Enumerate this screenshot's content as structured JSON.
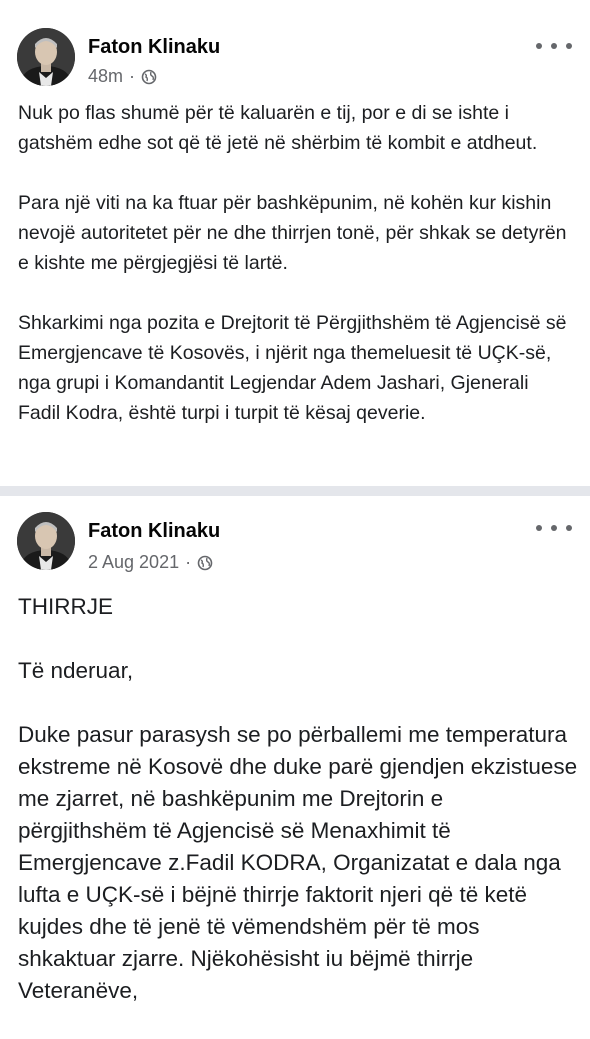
{
  "posts": [
    {
      "author": "Faton Klinaku",
      "time": "48m",
      "separator": "·",
      "privacy_icon": "globe-icon",
      "more_icon": "more-options-icon",
      "paragraphs": [
        "Nuk po flas shumë për të kaluarën e tij, por e di se ishte i gatshëm edhe sot që të jetë në shërbim të kombit e atdheut.",
        "Para një viti na ka ftuar për bashkëpunim, në kohën kur kishin nevojë autoritetet për ne dhe thirrjen tonë, për shkak se detyrën e kishte me përgjegjësi të lartë.",
        "Shkarkimi nga pozita e Drejtorit të Përgjithshëm të Agjencisë së Emergjencave të Kosovës, i njërit nga themeluesit të UÇK-së, nga grupi i Komandantit Legjendar Adem Jashari, Gjenerali Fadil Kodra, është turpi i turpit të kësaj qeverie."
      ]
    },
    {
      "author": "Faton Klinaku",
      "time": "2 Aug 2021",
      "separator": "·",
      "privacy_icon": "globe-icon",
      "more_icon": "more-options-icon",
      "paragraphs": [
        "THIRRJE",
        "Të nderuar,",
        "Duke pasur parasysh se po përballemi me temperatura ekstreme në Kosovë dhe duke parë gjendjen ekzistuese me zjarret, në bashkëpunim me Drejtorin e përgjithshëm të Agjencisë së Menaxhimit të Emergjencave z.Fadil KODRA, Organizatat e dala nga lufta e UÇK-së i bëjnë thirrje faktorit njeri që të ketë kujdes dhe të jenë të vëmendshëm për të mos shkaktuar zjarre. Njëkohësisht iu bëjmë thirrje Veteranëve,"
      ]
    }
  ],
  "colors": {
    "text": "#1c1e21",
    "meta": "#65676b",
    "separator": "#e4e6eb"
  }
}
